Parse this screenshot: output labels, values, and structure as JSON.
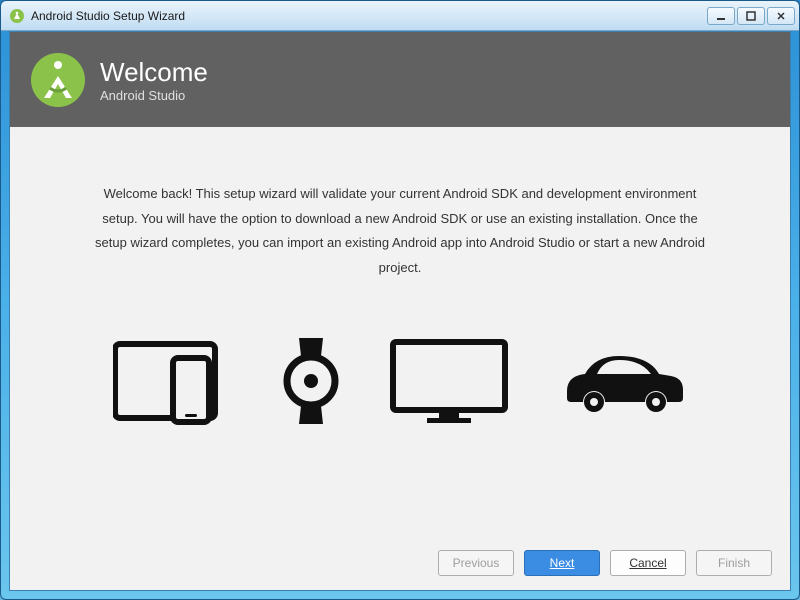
{
  "window": {
    "title": "Android Studio Setup Wizard"
  },
  "header": {
    "title": "Welcome",
    "subtitle": "Android Studio"
  },
  "content": {
    "welcome_text": "Welcome back! This setup wizard will validate your current Android SDK and development environment setup. You will have the option to download a new Android SDK or use an existing installation. Once the setup wizard completes, you can import an existing Android app into Android Studio or start a new Android project."
  },
  "footer": {
    "previous": "Previous",
    "next": "Next",
    "cancel": "Cancel",
    "finish": "Finish"
  }
}
